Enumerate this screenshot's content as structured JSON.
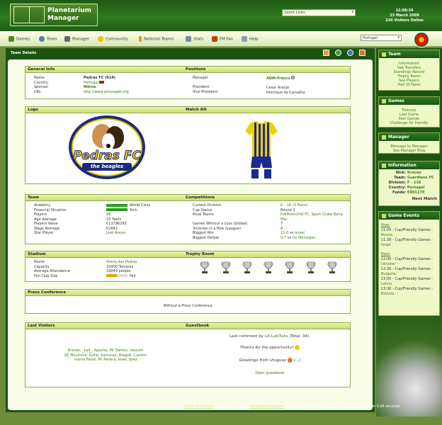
{
  "header": {
    "logo_line1": "Planetarium",
    "logo_line2": "Manager",
    "quick_links": "Quick Links",
    "time": "12:08:34",
    "date": "23 March 2009",
    "visitors": "234 Visitors Online"
  },
  "nav": {
    "items": [
      "Games",
      "Team",
      "Manager",
      "Community",
      "National Teams",
      "Stats",
      "FM Fan",
      "Help"
    ],
    "country": "Portugal"
  },
  "page": {
    "title": "Team Details"
  },
  "general": {
    "title": "General Info",
    "positions_title": "Positions",
    "labels": [
      "Name",
      "Country",
      "Sponsor",
      "URL"
    ],
    "name": "Pedras FC (614)",
    "country": "Portugal",
    "sponsor": "Nikisa",
    "url": "http://www.pmanager.org",
    "pos_labels": [
      "Manager",
      "President",
      "Vice-President"
    ],
    "manager": "ADM-Fresco",
    "president": "César Araújo",
    "vice": "Henrique de Carvalho"
  },
  "logo": {
    "title": "Logo",
    "kit_title": "Match Kit",
    "crest_line1": "Pedras FC",
    "crest_line2": "the beagles"
  },
  "team": {
    "title": "Team",
    "comp_title": "Competitions",
    "labels": [
      "Academy",
      "Financial Situation",
      "Players",
      "Age Average",
      "Players Value",
      "Wage Average",
      "Star Player"
    ],
    "academy": "World Class",
    "academy_level": 1.0,
    "financial": "Rich",
    "financial_level": 1.0,
    "players": "16",
    "age": "23 Years",
    "value": "€13796290",
    "wage": "€2841",
    "star": "José Areias",
    "comp_labels": [
      "Current Division",
      "Cup Status",
      "Rival Teams",
      "",
      "Games Without a Loss (Global)",
      "Victories in a Row (League)",
      "Biggest Win",
      "Biggest Defeat"
    ],
    "division": "D - 16 (3 Place)",
    "cup": "Round 3",
    "rivals1": "FullMoon2hill FC, Sport Clube Beira",
    "rivals2": "Mar",
    "gwl": "7",
    "vir": "4",
    "win_score": "11-0",
    "win_vs": "vs",
    "win_team": "Israel",
    "def_score": "0-7",
    "def_vs": "vs",
    "def_team": "Os Morcegos"
  },
  "stadium": {
    "title": "Stadium",
    "trophy_title": "Trophy Room",
    "labels": [
      "Name",
      "Capacity",
      "Average Attendance",
      "Fan Club Size"
    ],
    "name": "Arena das Pedras",
    "capacity": "32000 Terraces",
    "attendance": "19049 people",
    "fanclub": "Fair",
    "fanclub_level": 0.5
  },
  "press": {
    "title": "Press Conference",
    "text": "Without a Press Conference."
  },
  "visitors": {
    "title": "Last Visitors",
    "guest_title": "Guestbook",
    "lines": [
      "Kravex, _Lali_, Apache, Mr Santos, vascom",
      "28_Mourinho, Grillo, Samuraii, Diogo9, Cunhim",
      "marco Farali, Mr Pereira, level, Ibret"
    ],
    "last_comment_prefix": "Last comment by",
    "last_comment_user": "LA-LuKiTaAs",
    "last_comment_total": "(Total: 34):",
    "comment1": "Thanks for the opportunity!",
    "comment2": "Greetings from Uruguay",
    "comment2_tail": "(...)",
    "open": "Open guestbook"
  },
  "side": {
    "team_title": "Team",
    "team_links": [
      "Information",
      "See Transfers",
      "Standings Record",
      "Trophy Room",
      "See Players",
      "Hall Of Fame"
    ],
    "games_title": "Games",
    "games_links": [
      "Fixtures",
      "Last Game",
      "Past Games",
      "Challenge for friendly"
    ],
    "manager_title": "Manager",
    "manager_links": [
      "Message to Manager",
      "See Manager Blog"
    ],
    "info_title": "Information",
    "info_labels": [
      "Nick:",
      "Team:",
      "Division:",
      "Country:",
      "Funds:"
    ],
    "info_values": [
      "Kravex",
      "Guardians FC",
      "F - 116",
      "Portugal",
      "€801170"
    ],
    "next": "Next Match",
    "events_title": "Game Events",
    "now": "Now:",
    "next_label": "Next:",
    "now_events": [
      {
        "t": "11:00 - Cup/Friendly Games -",
        "c": "Russia"
      },
      {
        "t": "11:30 - Cup/Friendly Games -",
        "c": "Israel"
      }
    ],
    "next_events": [
      {
        "t": "12:00 - Cup/Friendly Games -",
        "c": "Ukraine"
      },
      {
        "t": "12:30 - Cup/Friendly Games -",
        "c": "Bulgaria"
      },
      {
        "t": "13:00 - Cup/Friendly Games -",
        "c": "Latvia"
      },
      {
        "t": "13:30 - Cup/Friendly Games -",
        "c": "Estonia"
      }
    ]
  },
  "footer": {
    "tos": "Terms of Service",
    "copy": "| Copyright © 2009",
    "company": "Planetarium Games",
    "rest": "(Portugal). All Rights Reserved - Page generated in 0,94 seconds"
  },
  "colors": {
    "dark_green": "#1c5512",
    "header_green": "#2f7a1e",
    "box_header": "#c8e070",
    "link": "#3f7b10"
  }
}
